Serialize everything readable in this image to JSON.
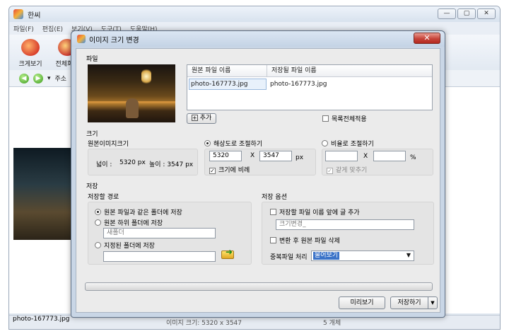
{
  "main_window": {
    "title": "한씨",
    "controls": [
      "—",
      "▢",
      "✕"
    ],
    "menu": [
      "파일(F)",
      "편집(E)",
      "보기(V)",
      "도구(T)",
      "도움말(H)"
    ],
    "toolbar": [
      {
        "label": "크게보기",
        "icon": "magnify-character-icon"
      },
      {
        "label": "전체화면",
        "icon": "fullscreen-character-icon"
      }
    ],
    "nav": {
      "back": "◀",
      "forward": "▶",
      "dropdown": "▾",
      "address_label": "주소"
    },
    "thumbnail_name": "photo-167773.jpg",
    "status": {
      "center": "이미지 크기: 5320 x 3547",
      "right": "5 개체"
    }
  },
  "dialog": {
    "title": "이미지 크기 변경",
    "close_label": "✕",
    "file_section": {
      "title": "파일",
      "columns": [
        "원본 파일 이름",
        "저장될 파일 이름"
      ],
      "rows": [
        {
          "original": "photo-167773.jpg",
          "target": "photo-167773.jpg"
        }
      ],
      "add_button": "추가",
      "apply_all_label": "목록전체적용",
      "apply_all_checked": false
    },
    "size_section": {
      "title": "크기",
      "original_size_label": "원본이미지크기",
      "width_label": "넓이 :",
      "width_value": "5320 px",
      "height_label": "높이 : 3547 px",
      "by_resolution_label": "해상도로 조절하기",
      "by_resolution_selected": true,
      "res_width": "5320",
      "res_height": "3547",
      "times": "X",
      "unit_px": "px",
      "keep_ratio_label": "크기에 비례",
      "keep_ratio_checked": true,
      "by_ratio_label": "비율로 조절하기",
      "by_ratio_selected": false,
      "ratio_width": "",
      "ratio_height": "",
      "unit_percent": "%",
      "same_ratio_label": "같게 맞추기",
      "same_ratio_checked": true
    },
    "save_section": {
      "title": "저장",
      "path_title": "저장할 경로",
      "opt_same_folder": "원본 파일과 같은 폴더에 저장",
      "opt_subfolder": "원본 하위 폴더에 저장",
      "subfolder_value": "새폴더",
      "opt_specified": "지정된 폴더에 저장",
      "specified_value": "",
      "selected_option": "same_folder",
      "options_title": "저장 옵션",
      "prefix_label": "저장할 파일 이름 앞에 글 추가",
      "prefix_checked": false,
      "prefix_value": "크기변경_",
      "delete_original_label": "변환 후 원본 파일 삭제",
      "delete_original_checked": false,
      "duplicate_label": "중복파일 처리",
      "duplicate_value": "물어보기"
    },
    "progress": 0,
    "buttons": {
      "preview": "미리보기",
      "save": "저장하기",
      "save_dropdown": "▼"
    }
  }
}
